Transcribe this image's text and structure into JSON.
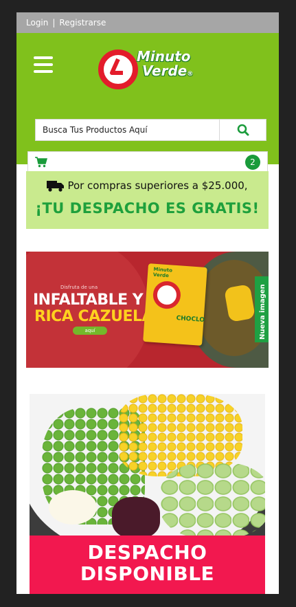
{
  "topbar": {
    "login": "Login",
    "separator": "|",
    "register": "Registrarse"
  },
  "logo": {
    "line1": "Minuto",
    "line2": "Verde",
    "mark": "®"
  },
  "search": {
    "placeholder": "Busca Tus Productos Aquí"
  },
  "cart": {
    "count": "2"
  },
  "promo": {
    "line1": "Por compras superiores a $25.000,",
    "line2": "¡TU DESPACHO ES GRATIS!"
  },
  "banner1": {
    "small": "Disfruta de una",
    "big1": "INFALTABLE Y",
    "big2": "RICA CAZUELA",
    "button": "aquí",
    "bag_brand_line1": "Minuto",
    "bag_brand_line2": "Verde",
    "bag_product": "CHOCLO",
    "side_tag": "Nueva imagen"
  },
  "banner2": {
    "line1": "DESPACHO",
    "line2": "DISPONIBLE"
  },
  "colors": {
    "brand_green": "#80c11c",
    "promo_bg": "#c9ea8e",
    "promo_text": "#1ea03c",
    "badge": "#1a9b3b",
    "banner_red": "#b8262e",
    "despacho_pink": "#f2184f"
  },
  "icons": [
    "hamburger-icon",
    "search-icon",
    "cart-icon",
    "truck-icon"
  ]
}
